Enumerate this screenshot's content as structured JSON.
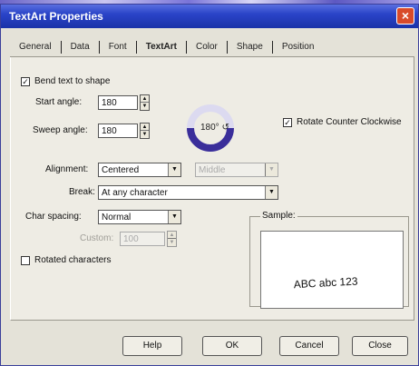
{
  "window": {
    "title": "TextArt Properties",
    "close_glyph": "×"
  },
  "tabs": [
    {
      "label": "General"
    },
    {
      "label": "Data"
    },
    {
      "label": "Font"
    },
    {
      "label": "TextArt",
      "active": true
    },
    {
      "label": "Color"
    },
    {
      "label": "Shape"
    },
    {
      "label": "Position"
    }
  ],
  "bend": {
    "checkbox_label": "Bend text to shape",
    "checked": true,
    "check_glyph": "✓"
  },
  "start_angle": {
    "label": "Start angle:",
    "value": "180"
  },
  "sweep_angle": {
    "label": "Sweep angle:",
    "value": "180"
  },
  "dial": {
    "readout": "180° ↺"
  },
  "rotate_ccw": {
    "label": "Rotate Counter Clockwise",
    "checked": true,
    "check_glyph": "✓"
  },
  "alignment": {
    "label": "Alignment:",
    "value": "Centered",
    "secondary_value": "Middle"
  },
  "break": {
    "label": "Break:",
    "value": "At any character"
  },
  "char_spacing": {
    "label": "Char spacing:",
    "value": "Normal"
  },
  "custom": {
    "label": "Custom:",
    "value": "100"
  },
  "rotated_characters": {
    "label": "Rotated characters",
    "checked": false
  },
  "sample": {
    "title": "Sample:",
    "text": "ABC abc 123"
  },
  "buttons": {
    "help": "Help",
    "ok": "OK",
    "cancel": "Cancel",
    "close": "Close"
  },
  "spinner": {
    "up_glyph": "▲",
    "down_glyph": "▼"
  },
  "combo_arrow_glyph": "▼"
}
